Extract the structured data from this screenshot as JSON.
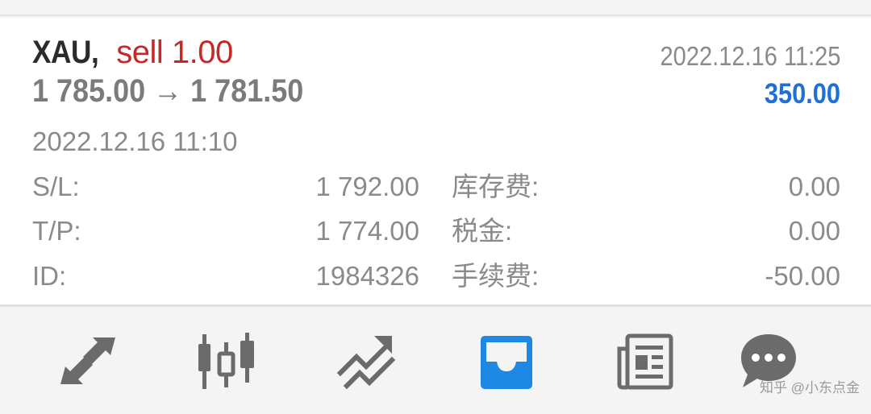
{
  "position": {
    "symbol": "XAU,",
    "trade_type": "sell 1.00",
    "open_price": "1 785.00",
    "arrow": "→",
    "current_price": "1 781.50",
    "close_time": "2022.12.16 11:25",
    "profit": "350.00",
    "open_time": "2022.12.16 11:10"
  },
  "details": [
    {
      "label": "S/L:",
      "value": "1 792.00",
      "label2": "库存费:",
      "value2": "0.00"
    },
    {
      "label": "T/P:",
      "value": "1 774.00",
      "label2": "税金:",
      "value2": "0.00"
    },
    {
      "label": "ID:",
      "value": "1984326",
      "label2": "手续费:",
      "value2": "-50.00"
    }
  ],
  "colors": {
    "sell": "#c62828",
    "profit": "#1e6fd6",
    "icon_active": "#1e88e5",
    "icon_inactive": "#6b6b6b"
  },
  "toolbar": {
    "items": [
      {
        "icon": "quotes-arrows-icon",
        "active": false
      },
      {
        "icon": "chart-candles-icon",
        "active": false
      },
      {
        "icon": "trade-trend-icon",
        "active": false
      },
      {
        "icon": "history-tray-icon",
        "active": true
      },
      {
        "icon": "news-icon",
        "active": false
      },
      {
        "icon": "chat-icon",
        "active": false
      }
    ]
  },
  "watermark": "知乎 @小东点金"
}
